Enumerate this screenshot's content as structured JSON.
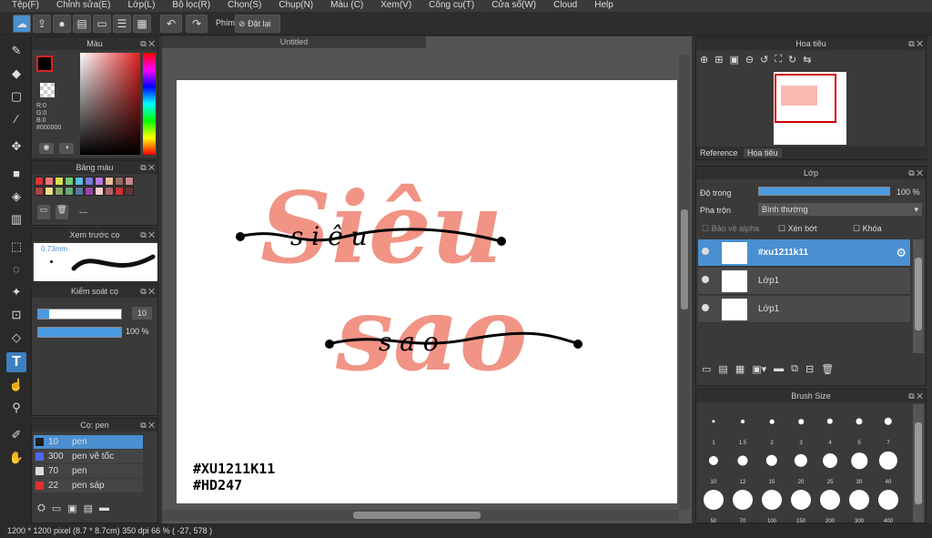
{
  "menu": [
    "Tệp(F)",
    "Chỉnh sửa(E)",
    "Lớp(L)",
    "Bộ lọc(R)",
    "Chọn(S)",
    "Chụp(N)",
    "Màu (C)",
    "Xem(V)",
    "Công cụ(T)",
    "Cửa sổ(W)",
    "Cloud",
    "Help"
  ],
  "toolbar": {
    "key_label": "Phím",
    "reset_label": "Đặt lại"
  },
  "color_panel": {
    "title": "Màu",
    "rgb": "R:0\nG:0\nB:0\n#000000"
  },
  "palette_panel": {
    "title": "Bảng màu",
    "dash": "---",
    "swatches": [
      "#d33",
      "#e77",
      "#dd5",
      "#7c7",
      "#5bd",
      "#77d",
      "#b7d",
      "#eb9",
      "#966",
      "#c88",
      "#a44",
      "#ed8",
      "#8a6",
      "#6a7",
      "#579",
      "#94a",
      "#fcc",
      "#a66",
      "#c33",
      "#633"
    ]
  },
  "preview_panel": {
    "title": "Xem trước cọ",
    "size": "0.73mm"
  },
  "brush_control": {
    "title": "Kiểm soát cọ",
    "size_val": "10",
    "opacity_val": "100 %",
    "size_frac": 0.13,
    "opacity_frac": 1.0
  },
  "brush_list": {
    "title": "Cọ: pen",
    "items": [
      {
        "size": "10",
        "name": "pen",
        "color": "#1e1e1e"
      },
      {
        "size": "300",
        "name": "pen vẽ tốc",
        "color": "#4d68f0"
      },
      {
        "size": "70",
        "name": "pen",
        "color": "#dddddd"
      },
      {
        "size": "22",
        "name": "pen sáp",
        "color": "#e03030"
      }
    ]
  },
  "document": {
    "title": "Untitled",
    "hashtag1": "#XU1211K11",
    "hashtag2": "#HD247",
    "word_top": "Siêu",
    "word_bottom": "sao",
    "script_top": "s i ê u",
    "script_bottom": "s a o"
  },
  "navigator": {
    "title": "Hoa tiêu",
    "tab_ref": "Reference",
    "tab_nav": "Hoa tiêu"
  },
  "layers": {
    "title": "Lớp",
    "opacity_label": "Độ trong",
    "opacity_val": "100 %",
    "blend_label": "Pha trộn",
    "blend_val": "Bình thường",
    "protect_alpha": "Bảo vệ alpha",
    "clip": "Xén bớt",
    "lock": "Khóa",
    "items": [
      {
        "name": "#xu1211k11",
        "selected": true
      },
      {
        "name": "Lớp1",
        "selected": false
      },
      {
        "name": "Lớp1",
        "selected": false
      }
    ]
  },
  "brush_size": {
    "title": "Brush Size",
    "sizes": [
      "1",
      "1.5",
      "2",
      "3",
      "4",
      "5",
      "7",
      "10",
      "12",
      "15",
      "20",
      "25",
      "30",
      "40",
      "50",
      "70",
      "100",
      "150",
      "200",
      "300",
      "400"
    ]
  },
  "status": {
    "text": "1200 * 1200 pixel  (8.7 * 8.7cm)  350 dpi  66 %  ( -27, 578 )"
  }
}
